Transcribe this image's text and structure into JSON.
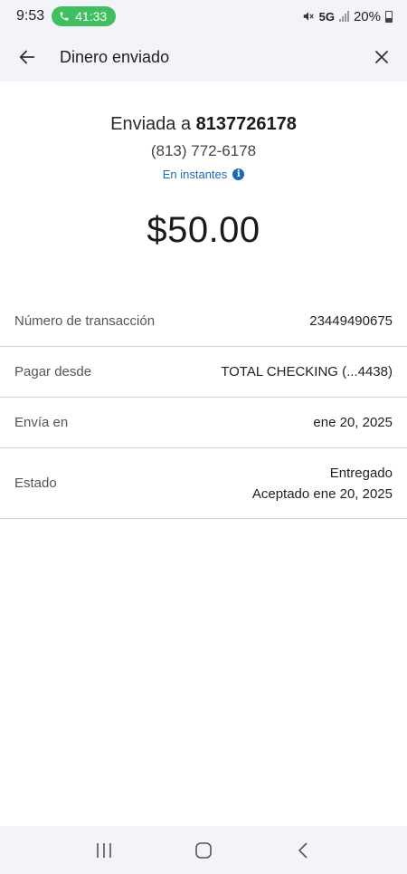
{
  "status_bar": {
    "time": "9:53",
    "call_timer": "41:33",
    "network": "5G",
    "battery": "20%",
    "call_color": "#3fbf5f"
  },
  "app_bar": {
    "title": "Dinero enviado",
    "back_icon": "arrow-left-icon",
    "close_icon": "close-icon"
  },
  "summary": {
    "sent_prefix": "Enviada a",
    "recipient": "8137726178",
    "phone_formatted": "(813) 772-6178",
    "speed_label": "En instantes",
    "info_glyph": "i",
    "amount": "$50.00",
    "link_color": "#1a6bb5"
  },
  "details": [
    {
      "label": "Número de transacción",
      "value": "23449490675"
    },
    {
      "label": "Pagar desde",
      "value": "TOTAL CHECKING (...4438)"
    },
    {
      "label": "Envía en",
      "value": "ene 20, 2025"
    },
    {
      "label": "Estado",
      "value": "Entregado",
      "value2": "Aceptado ene 20, 2025"
    }
  ],
  "nav_bar": {
    "recents_icon": "recent-apps-icon",
    "home_icon": "home-icon",
    "back_icon": "back-chevron-icon"
  }
}
